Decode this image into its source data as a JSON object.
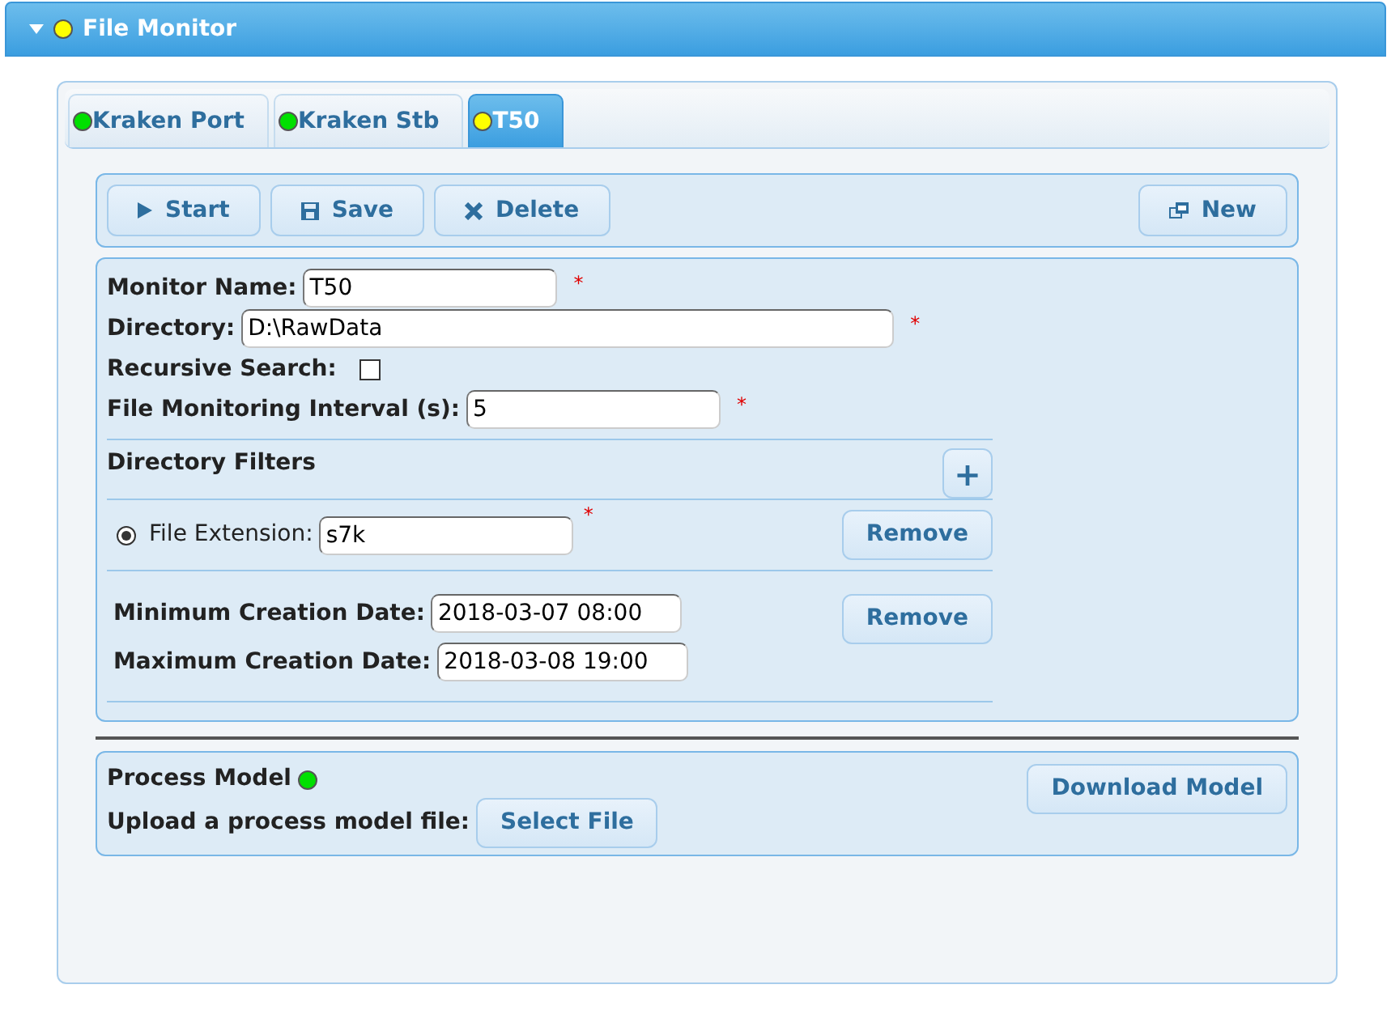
{
  "header": {
    "title": "File Monitor",
    "expanded": true,
    "color": "#ffff00"
  },
  "tabs": [
    {
      "label": "Kraken Port",
      "color": "#00e000",
      "selected": false
    },
    {
      "label": "Kraken Stb",
      "color": "#00e000",
      "selected": false
    },
    {
      "label": "T50",
      "color": "#ffff00",
      "selected": true
    }
  ],
  "toolbar": {
    "buttons": [
      {
        "label": "Start",
        "kind": "start"
      },
      {
        "label": "Save",
        "kind": "save"
      },
      {
        "label": "Delete",
        "kind": "delete"
      }
    ],
    "new_button": "New"
  },
  "fields": [
    {
      "kind": "text",
      "label": "Monitor Name:",
      "value": "T50",
      "required_mark": "*"
    },
    {
      "kind": "path",
      "label": "Directory:",
      "value": "D:\\RawData",
      "required_mark": "*"
    },
    {
      "kind": "checkbox",
      "label": "Recursive Search:",
      "checked": false
    },
    {
      "kind": "text",
      "label": "File Monitoring Interval (s):",
      "value": "5",
      "required_mark": "*"
    }
  ],
  "directory_filters": {
    "title": "Directory Filters",
    "add_icon": "+",
    "filters": [
      {
        "kind": "extension",
        "selected": true,
        "label": "File Extension:",
        "value": "s7k",
        "required_mark": "*",
        "remove": "Remove"
      },
      {
        "kind": "dates",
        "remove": "Remove",
        "rows": [
          {
            "label": "Minimum Creation Date:",
            "value": "2018-03-07 08:00"
          },
          {
            "label": "Maximum Creation Date:",
            "value": "2018-03-08 19:00"
          }
        ]
      }
    ]
  },
  "process_model": {
    "title": "Process Model",
    "color": "#00e000",
    "upload_label": "Upload a process model file:",
    "select_button": "Select File",
    "download_button": "Download Model"
  }
}
